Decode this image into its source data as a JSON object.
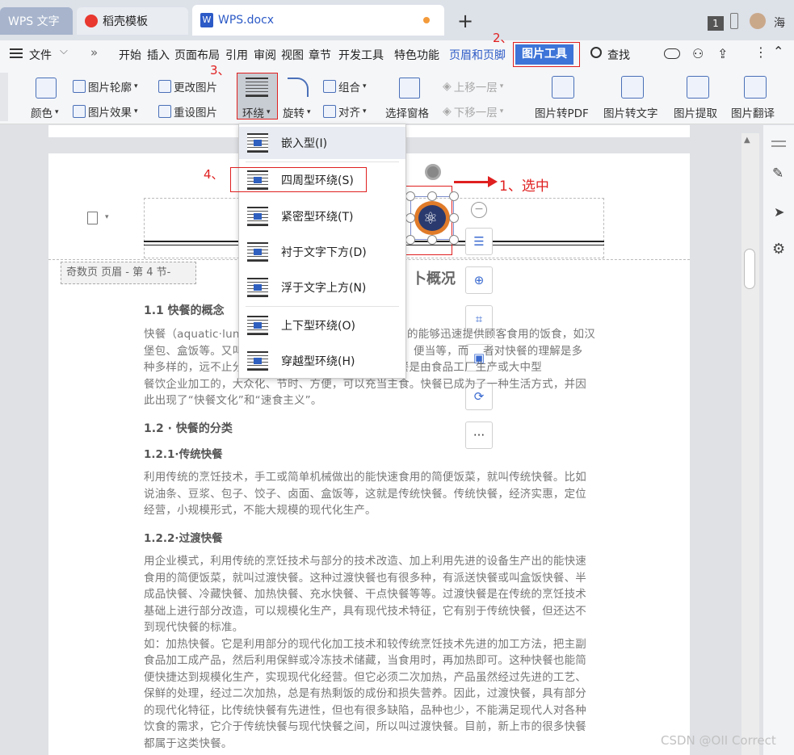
{
  "tabs": {
    "wps": "WPS 文字",
    "daoke": "稻壳模板",
    "doc": "WPS.docx",
    "badge": "1",
    "user": "海"
  },
  "menu": {
    "file": "文件",
    "items": [
      "开始",
      "插入",
      "页面布局",
      "引用",
      "审阅",
      "视图",
      "章节",
      "开发工具",
      "特色功能"
    ],
    "header_footer": "页眉和页脚",
    "picture_tools": "图片工具",
    "find": "查找"
  },
  "toolbar": {
    "color": "颜色",
    "outline": "图片轮廓",
    "effect": "图片效果",
    "change": "更改图片",
    "reset": "重设图片",
    "wrap": "环绕",
    "rotate": "旋转",
    "group": "组合",
    "align": "对齐",
    "select_pane": "选择窗格",
    "bring_forward": "上移一层",
    "send_backward": "下移一层",
    "to_pdf": "图片转PDF",
    "to_text": "图片转文字",
    "extract": "图片提取",
    "translate": "图片翻译"
  },
  "annotations": {
    "a1": "1、选中",
    "a2": "2、",
    "a3": "3、",
    "a4": "4、"
  },
  "wrap_menu": [
    "嵌入型(I)",
    "四周型环绕(S)",
    "紧密型环绕(T)",
    "衬于文字下方(D)",
    "浮于文字上方(N)",
    "上下型环绕(O)",
    "穿越型环绕(H)"
  ],
  "doc": {
    "header_label": "奇数页 页眉 - 第 4 节-",
    "title_fragment": "卜概况",
    "h11": "1.1 快餐的概念",
    "p1": [
      "快餐（aquatic·lunch",
      "的能够迅速提供顾客食用的饭食，如汉",
      "堡包、盒饭等。又叫",
      "便当等，而",
      "者对快餐的理解是多",
      "种多样的，远不止分",
      "点，即快餐是由食品工厂生产或大中型",
      "餐饮企业加工的，大众化、节时、方便，可以充当主食。快餐已成为了一种生活方式，并因",
      "此出现了“快餐文化”和“速食主义”。"
    ],
    "h12": "1.2 · 快餐的分类",
    "h121": "1.2.1·传统快餐",
    "p2": [
      "利用传统的烹饪技术，手工或简单机械做出的能快速食用的简便饭菜，就叫传统快餐。比如",
      "说油条、豆浆、包子、饺子、卤面、盒饭等，这就是传统快餐。传统快餐，经济实惠，定位",
      "经营，小规模形式，不能大规模的现代化生产。"
    ],
    "h122": "1.2.2·过渡快餐",
    "p3": [
      "用企业模式，利用传统的烹饪技术与部分的技术改造、加上利用先进的设备生产出的能快速",
      "食用的简便饭菜，就叫过渡快餐。这种过渡快餐也有很多种，有派送快餐或叫盒饭快餐、半",
      "成品快餐、冷藏快餐、加热快餐、充水快餐、干点快餐等等。过渡快餐是在传统的烹饪技术",
      "基础上进行部分改造，可以规模化生产，具有现代技术特征，它有别于传统快餐，但还达不",
      "到现代快餐的标准。",
      "如：加热快餐。它是利用部分的现代化加工技术和较传统烹饪技术先进的加工方法，把主副",
      "食品加工成产品，然后利用保鲜或冷冻技术储藏，当食用时，再加热即可。这种快餐也能简",
      "便快捷达到规模化生产，实现现代化经营。但它必须二次加热，产品虽然经过先进的工艺、",
      "保鲜的处理，经过二次加热，总是有热剩饭的成份和损失营养。因此，过渡快餐，具有部分",
      "的现代化特征，比传统快餐有先进性，但也有很多缺陷，品种也少，不能满足现代人对各种",
      "饮食的需求，它介于传统快餐与现代快餐之间，所以叫过渡快餐。目前，新上市的很多快餐",
      "都属于这类快餐。"
    ]
  },
  "watermark": "CSDN @OII Correct"
}
